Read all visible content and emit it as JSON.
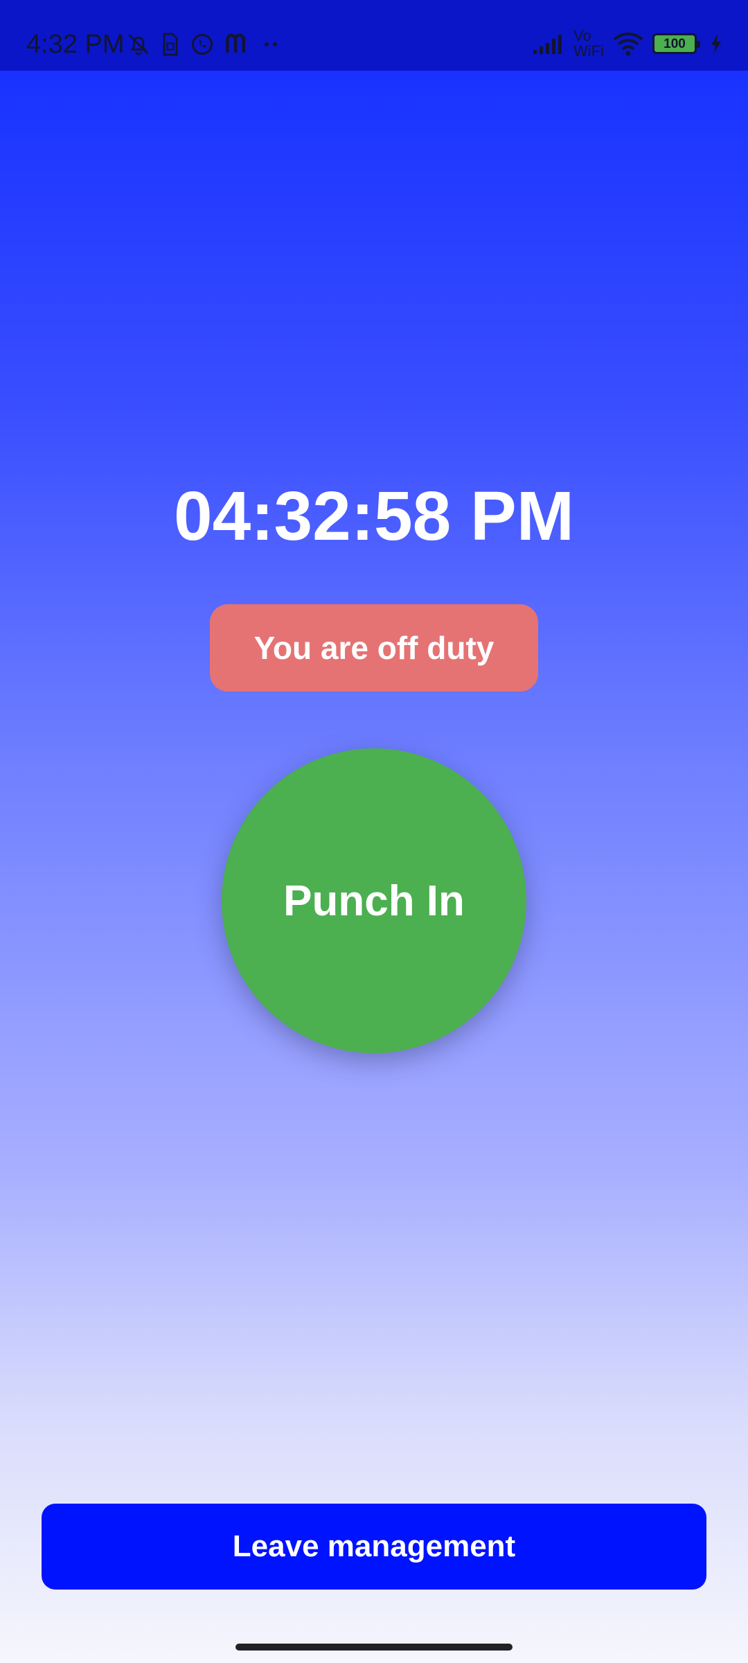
{
  "status_bar": {
    "time": "4:32 PM",
    "left_icons": [
      "bell-off-icon",
      "sim-icon",
      "whatsapp-icon",
      "m-app-icon",
      "more-dots-icon"
    ],
    "vowifi_top": "Vo",
    "vowifi_bottom": "WiFi",
    "battery_level": "100",
    "right_icons": [
      "signal-icon",
      "vowifi-icon",
      "wifi-icon",
      "battery-icon",
      "charging-icon"
    ]
  },
  "main": {
    "clock": "04:32:58 PM",
    "duty_status": "You are off duty",
    "punch_label": "Punch In"
  },
  "footer": {
    "leave_label": "Leave management"
  },
  "colors": {
    "status_bar_bg": "#0a16c8",
    "gradient_top": "#1226ff",
    "gradient_bottom": "#f6f6fd",
    "duty_badge": "#e57373",
    "punch_button": "#4caf50",
    "leave_button": "#0013ff",
    "text_primary": "#ffffff"
  }
}
